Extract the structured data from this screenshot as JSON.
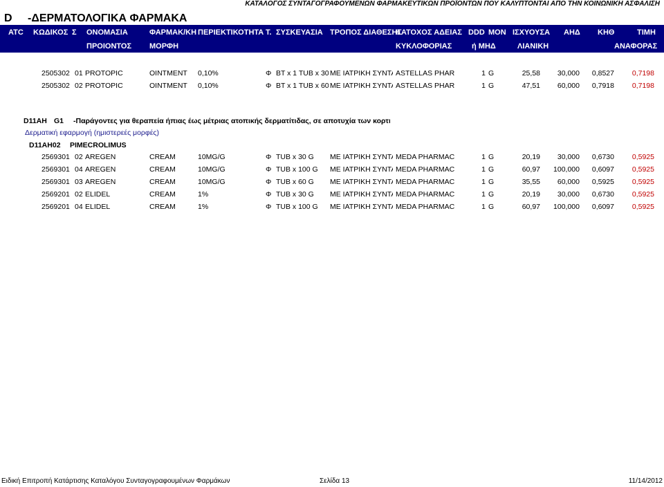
{
  "header": {
    "category_code": "D",
    "category_title": "-ΔΕΡΜΑΤΟΛΟΓΙΚΑ ΦΑΡΜΑΚΑ",
    "catalog_title": "ΚΑΤΑΛΟΓΟΣ ΣΥΝΤΑΓΟΓΡΑΦΟΥΜΕΝΩΝ ΦΑΡΜΑΚΕΥΤΙΚΩΝ ΠΡΟΪΟΝΤΩΝ ΠΟΥ ΚΑΛΥΠΤΟΝΤΑΙ ΑΠΟ ΤΗΝ ΚΟΙΝΩΝΙΚΗ ΑΣΦΑΛΙΣΗ"
  },
  "columns": {
    "atc": "ATC",
    "code": "ΚΩΔΙΚΟΣ",
    "s": "Σ",
    "name": "ΟΝΟΜΑΣΙΑ",
    "name2": "ΠΡΟΙΟΝΤΟΣ",
    "form": "ΦΑΡΜΑΚ/ΚΗ",
    "form2": "ΜΟΡΦΗ",
    "strength": "ΠΕΡΙΕΚΤΙΚΟΤΗΤΑ",
    "t": "Τ.",
    "package": "ΣΥΣΚΕΥΑΣΙΑ",
    "dispense": "ΤΡΟΠΟΣ ΔΙΑΘΕΣΗΣ",
    "holder": "ΚΑΤΟΧΟΣ ΑΔΕΙΑΣ",
    "holder2": "ΚΥΚΛΟΦΟΡΙΑΣ",
    "ddd": "DDD",
    "unit": "ΜΟΝ",
    "unit2": "ή ΜΗΔ",
    "valid": "ΙΣΧΥΟΥΣΑ",
    "valid2": "ΛΙΑΝΙΚΗ",
    "ahd": "ΑΗΔ",
    "khth": "ΚΗΘ",
    "price": "ΤΙΜΗ",
    "price2": "ΑΝΑΦΟΡΑΣ"
  },
  "rows_a": [
    {
      "code": "2505302",
      "s": "01",
      "name": "PROTOPIC",
      "form": "OINTMENT",
      "strength": "0,10%",
      "t": "Φ",
      "package": "BT x 1 TUB x 30",
      "dispense": "ΜΕ ΙΑΤΡΙΚΗ ΣΥΝΤΑ",
      "holder": "ASTELLAS PHARI",
      "ddd": "1",
      "unit": "G",
      "price": "25,58",
      "ahd": "30,000",
      "khth": "0,8527",
      "ref": "0,7198"
    },
    {
      "code": "2505302",
      "s": "02",
      "name": "PROTOPIC",
      "form": "OINTMENT",
      "strength": "0,10%",
      "t": "Φ",
      "package": "BT x 1 TUB x 60",
      "dispense": "ΜΕ ΙΑΤΡΙΚΗ ΣΥΝΤΑ",
      "holder": "ASTELLAS PHARI",
      "ddd": "1",
      "unit": "G",
      "price": "47,51",
      "ahd": "60,000",
      "khth": "0,7918",
      "ref": "0,7198"
    }
  ],
  "group": {
    "atc": "D11AH",
    "g": "G1",
    "desc": "-Παράγοντες για θεραπεία ήπιας έως μέτριας ατοπικής δερματίτιδας, σε αποτυχία των κορτικοσ",
    "sub": "Δερματική εφαρμογή (ημιστερεές μορφές)",
    "sub_atc": "D11AH02",
    "sub_name": "PIMECROLIMUS"
  },
  "rows_b": [
    {
      "code": "2569301",
      "s": "02",
      "name": "AREGEN",
      "form": "CREAM",
      "strength": "10MG/G",
      "t": "Φ",
      "package": "TUB x 30 G",
      "dispense": "ΜΕ ΙΑΤΡΙΚΗ ΣΥΝΤΑ",
      "holder": "MEDA PHARMACI",
      "ddd": "1",
      "unit": "G",
      "price": "20,19",
      "ahd": "30,000",
      "khth": "0,6730",
      "ref": "0,5925"
    },
    {
      "code": "2569301",
      "s": "04",
      "name": "AREGEN",
      "form": "CREAM",
      "strength": "10MG/G",
      "t": "Φ",
      "package": "TUB x 100 G",
      "dispense": "ΜΕ ΙΑΤΡΙΚΗ ΣΥΝΤΑ",
      "holder": "MEDA PHARMACI",
      "ddd": "1",
      "unit": "G",
      "price": "60,97",
      "ahd": "100,000",
      "khth": "0,6097",
      "ref": "0,5925"
    },
    {
      "code": "2569301",
      "s": "03",
      "name": "AREGEN",
      "form": "CREAM",
      "strength": "10MG/G",
      "t": "Φ",
      "package": "TUB x 60 G",
      "dispense": "ΜΕ ΙΑΤΡΙΚΗ ΣΥΝΤΑ",
      "holder": "MEDA PHARMACI",
      "ddd": "1",
      "unit": "G",
      "price": "35,55",
      "ahd": "60,000",
      "khth": "0,5925",
      "ref": "0,5925"
    },
    {
      "code": "2569201",
      "s": "02",
      "name": "ELIDEL",
      "form": "CREAM",
      "strength": "1%",
      "t": "Φ",
      "package": "TUB x 30 G",
      "dispense": "ΜΕ ΙΑΤΡΙΚΗ ΣΥΝΤΑ",
      "holder": "MEDA PHARMACI",
      "ddd": "1",
      "unit": "G",
      "price": "20,19",
      "ahd": "30,000",
      "khth": "0,6730",
      "ref": "0,5925"
    },
    {
      "code": "2569201",
      "s": "04",
      "name": "ELIDEL",
      "form": "CREAM",
      "strength": "1%",
      "t": "Φ",
      "package": "TUB x 100 G",
      "dispense": "ΜΕ ΙΑΤΡΙΚΗ ΣΥΝΤΑ",
      "holder": "MEDA PHARMACI",
      "ddd": "1",
      "unit": "G",
      "price": "60,97",
      "ahd": "100,000",
      "khth": "0,6097",
      "ref": "0,5925"
    }
  ],
  "footer": {
    "left": "Ειδική Επιτροπή Κατάρτισης Καταλόγου Συνταγογραφουμένων Φαρμάκων",
    "page": "Σελίδα 13",
    "date": "11/14/2012"
  },
  "colors": {
    "header_bg": "#000080",
    "header_text": "#ffffff",
    "ref_price": "#c00000",
    "group_sub": "#1a1a8c"
  }
}
